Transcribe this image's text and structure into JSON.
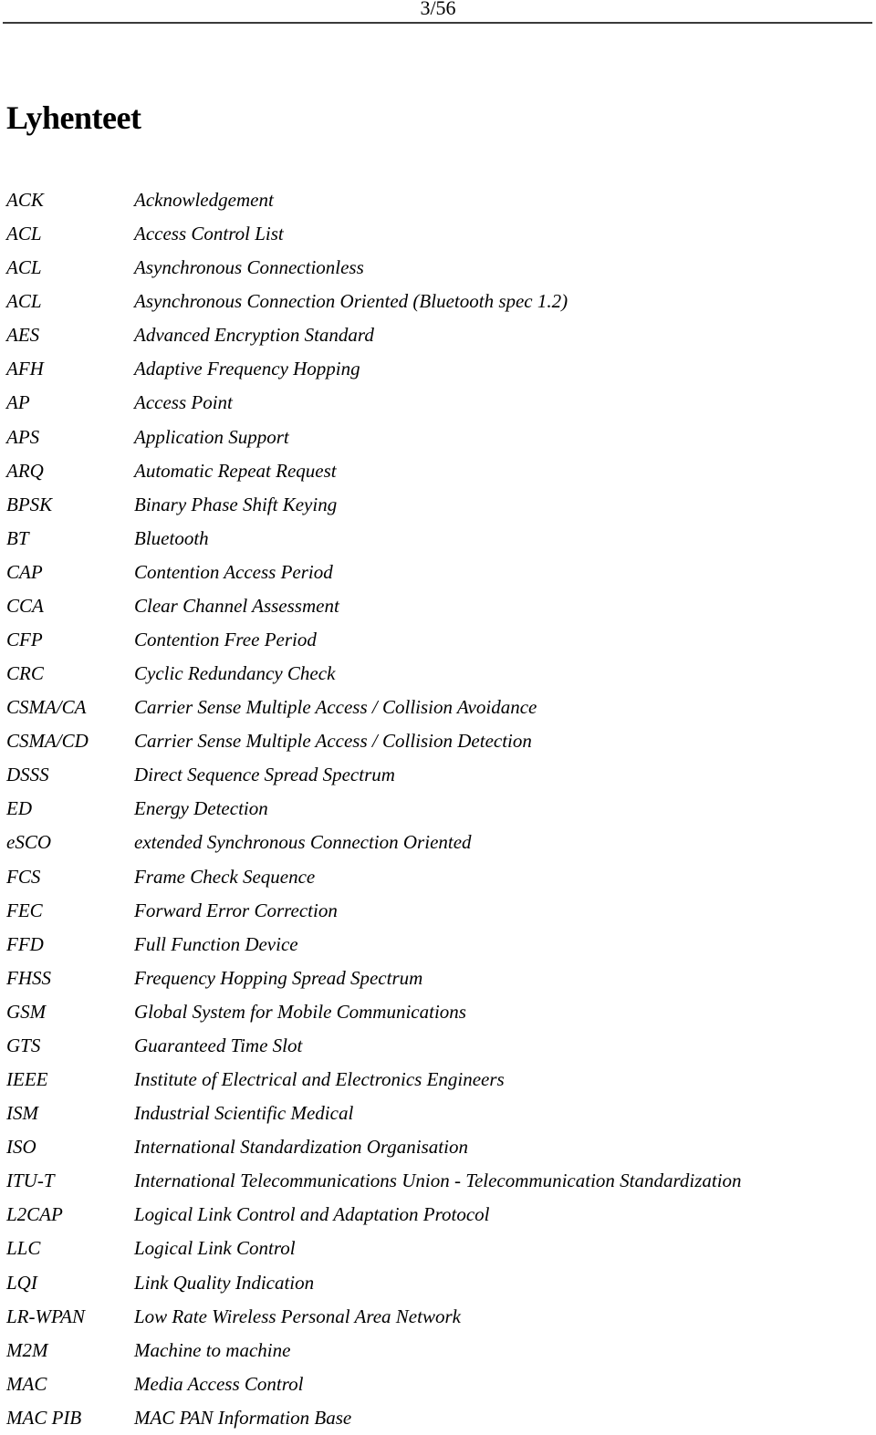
{
  "header": {
    "page_number": "3/56"
  },
  "title": "Lyhenteet",
  "abbreviations": [
    {
      "term": "ACK",
      "definition": "Acknowledgement"
    },
    {
      "term": "ACL",
      "definition": "Access Control List"
    },
    {
      "term": "ACL",
      "definition": "Asynchronous Connectionless"
    },
    {
      "term": "ACL",
      "definition": "Asynchronous Connection Oriented (Bluetooth spec 1.2)"
    },
    {
      "term": "AES",
      "definition": "Advanced Encryption Standard"
    },
    {
      "term": "AFH",
      "definition": "Adaptive Frequency Hopping"
    },
    {
      "term": "AP",
      "definition": "Access Point"
    },
    {
      "term": "APS",
      "definition": "Application Support"
    },
    {
      "term": "ARQ",
      "definition": "Automatic Repeat Request"
    },
    {
      "term": "BPSK",
      "definition": "Binary Phase Shift Keying"
    },
    {
      "term": "BT",
      "definition": "Bluetooth"
    },
    {
      "term": "CAP",
      "definition": "Contention Access Period"
    },
    {
      "term": "CCA",
      "definition": "Clear Channel Assessment"
    },
    {
      "term": "CFP",
      "definition": "Contention Free Period"
    },
    {
      "term": "CRC",
      "definition": "Cyclic Redundancy Check"
    },
    {
      "term": "CSMA/CA",
      "definition": "Carrier Sense Multiple Access / Collision Avoidance"
    },
    {
      "term": "CSMA/CD",
      "definition": "Carrier Sense Multiple Access / Collision Detection"
    },
    {
      "term": "DSSS",
      "definition": "Direct Sequence Spread Spectrum"
    },
    {
      "term": "ED",
      "definition": "Energy Detection"
    },
    {
      "term": "eSCO",
      "definition": "extended Synchronous Connection Oriented"
    },
    {
      "term": "FCS",
      "definition": "Frame Check Sequence"
    },
    {
      "term": "FEC",
      "definition": "Forward Error Correction"
    },
    {
      "term": "FFD",
      "definition": "Full Function Device"
    },
    {
      "term": "FHSS",
      "definition": "Frequency Hopping Spread Spectrum"
    },
    {
      "term": "GSM",
      "definition": "Global System for Mobile Communications"
    },
    {
      "term": "GTS",
      "definition": "Guaranteed Time Slot"
    },
    {
      "term": "IEEE",
      "definition": "Institute of Electrical and Electronics Engineers"
    },
    {
      "term": "ISM",
      "definition": "Industrial Scientific Medical"
    },
    {
      "term": "ISO",
      "definition": "International Standardization Organisation"
    },
    {
      "term": "ITU-T",
      "definition": "International Telecommunications Union - Telecommunication Standardization"
    },
    {
      "term": "L2CAP",
      "definition": "Logical Link Control and Adaptation Protocol"
    },
    {
      "term": "LLC",
      "definition": "Logical Link Control"
    },
    {
      "term": "LQI",
      "definition": "Link Quality Indication"
    },
    {
      "term": "LR-WPAN",
      "definition": "Low Rate Wireless Personal Area Network"
    },
    {
      "term": "M2M",
      "definition": "Machine to machine"
    },
    {
      "term": "MAC",
      "definition": "Media Access Control"
    },
    {
      "term": "MAC PIB",
      "definition": "MAC PAN Information Base"
    }
  ]
}
